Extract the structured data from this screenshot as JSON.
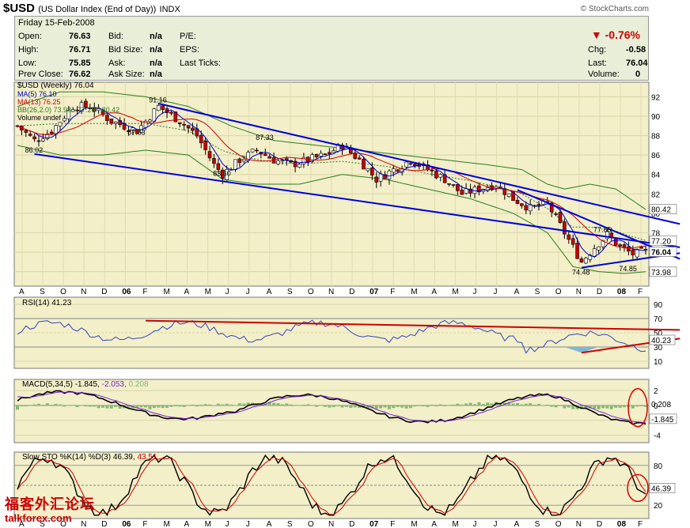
{
  "header": {
    "symbol": "$USD",
    "name": "(US Dollar Index (End of Day))",
    "exchange": "INDX",
    "credit": "© StockCharts.com"
  },
  "quote": {
    "date": "Friday  15-Feb-2008",
    "open_label": "Open:",
    "open": "76.63",
    "high_label": "High:",
    "high": "76.71",
    "low_label": "Low:",
    "low": "75.85",
    "prev_label": "Prev Close:",
    "prev": "76.62",
    "bid_label": "Bid:",
    "bid": "n/a",
    "bidsize_label": "Bid Size:",
    "bidsize": "n/a",
    "ask_label": "Ask:",
    "ask": "n/a",
    "asksize_label": "Ask Size:",
    "asksize": "n/a",
    "pe_label": "P/E:",
    "eps_label": "EPS:",
    "lastticks_label": "Last Ticks:",
    "volume_label": "Volume:",
    "volume": "0",
    "change_pct": "-0.76%",
    "chg_label": "Chg:",
    "chg": "-0.58",
    "last_label": "Last:",
    "last": "76.04"
  },
  "colors": {
    "panel_bg": "#f2efc9",
    "up": "#ffffff",
    "down": "#cc0000",
    "ma5": "#0000cc",
    "ma13": "#cc0000",
    "bb": "#2e7d1f",
    "trend": "#0000dd"
  },
  "chart_data": {
    "type": "line",
    "price": {
      "legend": [
        "$USD (Weekly) 76.04",
        "MA(5) 76.10",
        "MA(13) 76.25",
        "BB(26,2.0) 73.98 - 77.20 - 80.42",
        "Volume undef"
      ],
      "y_ticks": [
        74,
        76,
        78,
        80,
        82,
        84,
        86,
        88,
        90,
        92
      ],
      "ylim": [
        72.5,
        93.5
      ],
      "x_labels": [
        "A",
        "S",
        "O",
        "N",
        "D",
        "06",
        "F",
        "M",
        "A",
        "M",
        "J",
        "J",
        "A",
        "S",
        "O",
        "N",
        "D",
        "07",
        "F",
        "M",
        "A",
        "M",
        "J",
        "J",
        "A",
        "S",
        "O",
        "N",
        "D",
        "08",
        "F"
      ],
      "annotations": [
        {
          "text": "91.16",
          "i": 33,
          "v": 91.16
        },
        {
          "text": "86.02",
          "i": 4,
          "v": 86.02
        },
        {
          "text": "87.83",
          "i": 28,
          "v": 87.83
        },
        {
          "text": "83.60",
          "i": 48,
          "v": 83.6
        },
        {
          "text": "87.33",
          "i": 58,
          "v": 87.33
        },
        {
          "text": "77.85",
          "i": 137,
          "v": 77.85
        },
        {
          "text": "74.48",
          "i": 132,
          "v": 74.48
        },
        {
          "text": "74.85",
          "i": 143,
          "v": 74.85
        }
      ],
      "right_labels": [
        {
          "text": "80.42",
          "v": 80.42
        },
        {
          "text": "77.20",
          "v": 77.2
        },
        {
          "text": "76.04",
          "v": 76.04
        },
        {
          "text": "73.98",
          "v": 73.98
        }
      ],
      "close_anchors": [
        [
          0,
          89
        ],
        [
          4,
          87.5
        ],
        [
          8,
          88.5
        ],
        [
          13,
          91
        ],
        [
          17,
          91
        ],
        [
          22,
          89.5
        ],
        [
          28,
          88.5
        ],
        [
          33,
          91
        ],
        [
          38,
          89.5
        ],
        [
          42,
          88
        ],
        [
          46,
          85
        ],
        [
          48,
          84
        ],
        [
          52,
          85.5
        ],
        [
          56,
          86.5
        ],
        [
          60,
          85.5
        ],
        [
          64,
          85
        ],
        [
          68,
          85.5
        ],
        [
          72,
          86
        ],
        [
          76,
          87
        ],
        [
          80,
          85.5
        ],
        [
          84,
          83.5
        ],
        [
          88,
          84.5
        ],
        [
          92,
          85.5
        ],
        [
          96,
          84.5
        ],
        [
          100,
          83.5
        ],
        [
          104,
          82
        ],
        [
          108,
          82.5
        ],
        [
          112,
          83
        ],
        [
          116,
          81.5
        ],
        [
          120,
          80.5
        ],
        [
          124,
          81
        ],
        [
          128,
          78
        ],
        [
          132,
          75
        ],
        [
          135,
          76.5
        ],
        [
          138,
          77.8
        ],
        [
          141,
          76.5
        ],
        [
          144,
          75.8
        ],
        [
          147,
          76.04
        ]
      ],
      "bb_upper": [
        [
          0,
          91
        ],
        [
          10,
          92.5
        ],
        [
          20,
          92.5
        ],
        [
          30,
          92
        ],
        [
          40,
          91
        ],
        [
          50,
          89
        ],
        [
          60,
          87.5
        ],
        [
          70,
          87
        ],
        [
          80,
          86.5
        ],
        [
          90,
          86
        ],
        [
          100,
          85.5
        ],
        [
          110,
          85
        ],
        [
          118,
          84.5
        ],
        [
          124,
          83
        ],
        [
          128,
          82.5
        ],
        [
          134,
          83
        ],
        [
          140,
          82.5
        ],
        [
          147,
          80.4
        ]
      ],
      "bb_lower": [
        [
          0,
          87
        ],
        [
          10,
          86
        ],
        [
          20,
          86
        ],
        [
          30,
          86.5
        ],
        [
          40,
          86
        ],
        [
          48,
          83.5
        ],
        [
          56,
          83
        ],
        [
          66,
          83
        ],
        [
          76,
          84
        ],
        [
          86,
          83.5
        ],
        [
          96,
          82.5
        ],
        [
          106,
          81.5
        ],
        [
          116,
          80
        ],
        [
          124,
          78
        ],
        [
          130,
          74.5
        ],
        [
          136,
          74
        ],
        [
          142,
          73.8
        ],
        [
          147,
          73.98
        ]
      ],
      "trendlines": [
        {
          "from": [
            33,
            91.3
          ],
          "to": [
            155,
            78.9
          ]
        },
        {
          "from": [
            4,
            86.1
          ],
          "to": [
            155,
            76.5
          ]
        },
        {
          "from": [
            117,
            82.4
          ],
          "to": [
            155,
            75.3
          ]
        },
        {
          "from": [
            132,
            74.4
          ],
          "to": [
            155,
            75.9
          ]
        }
      ]
    },
    "rsi": {
      "legend": "RSI(14) 41.23",
      "y_ticks": [
        10,
        30,
        50,
        70,
        90
      ],
      "ylim": [
        0,
        100
      ],
      "value_label": "40.23"
    },
    "macd": {
      "legend_name": "MACD(5,34,5)",
      "legend_macd": "-1.845,",
      "legend_signal": "-2.053,",
      "legend_hist": "0.208",
      "y_ticks": [
        -4,
        -2,
        0,
        2
      ],
      "ylim": [
        -5,
        3.5
      ],
      "hist_label": "0.208",
      "macd_label": "-1.845"
    },
    "sto": {
      "legend_name": "Slow STO %K(14) %D(3)",
      "legend_k": "46.39,",
      "legend_d": "43.51",
      "y_ticks": [
        20,
        50,
        80
      ],
      "ylim": [
        0,
        100
      ],
      "value_label": "46.39"
    }
  },
  "watermark": {
    "line1": "福客外汇论坛",
    "line2": "talkforex.com"
  }
}
